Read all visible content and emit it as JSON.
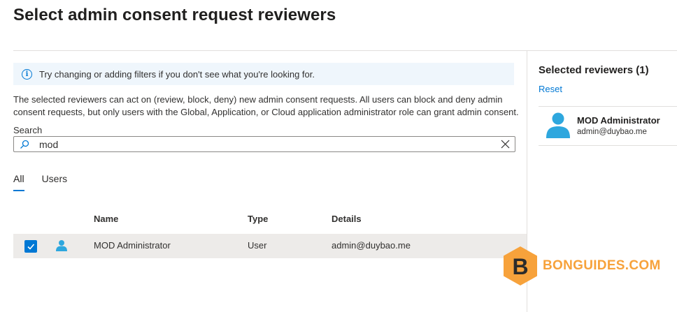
{
  "page": {
    "title": "Select admin consent request reviewers"
  },
  "info_bar": {
    "text": "Try changing or adding filters if you don't see what you're looking for."
  },
  "description": "The selected reviewers can act on (review, block, deny) new admin consent requests. All users can block and deny admin consent requests, but only users with the Global, Application, or Cloud application administrator role can grant admin consent.",
  "search": {
    "label": "Search",
    "value": "mod"
  },
  "tabs": [
    {
      "label": "All",
      "active": true
    },
    {
      "label": "Users",
      "active": false
    }
  ],
  "table": {
    "columns": [
      "Name",
      "Type",
      "Details"
    ],
    "rows": [
      {
        "checked": true,
        "name": "MOD Administrator",
        "type": "User",
        "details": "admin@duybao.me"
      }
    ]
  },
  "selected_panel": {
    "title": "Selected reviewers (1)",
    "reset_label": "Reset",
    "items": [
      {
        "name": "MOD Administrator",
        "email": "admin@duybao.me"
      }
    ]
  },
  "watermark": {
    "text": "BONGUIDES.COM",
    "letter": "B"
  },
  "colors": {
    "accent": "#0078d4",
    "info_bg": "#eff6fc",
    "row_selected": "#edebe9",
    "watermark": "#f7a23b"
  }
}
